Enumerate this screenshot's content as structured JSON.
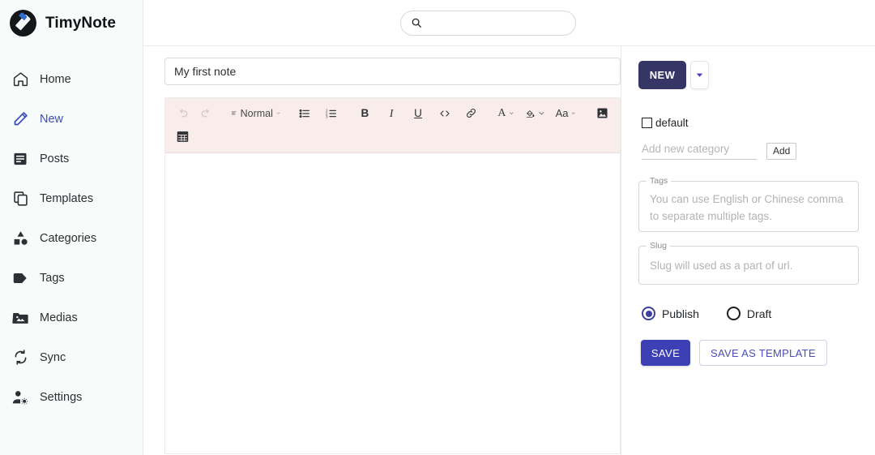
{
  "app": {
    "brand": "TimyNote",
    "logo_icon": "pen-circle-logo"
  },
  "sidebar": {
    "items": [
      {
        "label": "Home",
        "icon": "home-icon",
        "active": false
      },
      {
        "label": "New",
        "icon": "pencil-icon",
        "active": true
      },
      {
        "label": "Posts",
        "icon": "article-icon",
        "active": false
      },
      {
        "label": "Templates",
        "icon": "copy-icon",
        "active": false
      },
      {
        "label": "Categories",
        "icon": "category-icon",
        "active": false
      },
      {
        "label": "Tags",
        "icon": "tag-icon",
        "active": false
      },
      {
        "label": "Medias",
        "icon": "image-folder-icon",
        "active": false
      },
      {
        "label": "Sync",
        "icon": "sync-icon",
        "active": false
      },
      {
        "label": "Settings",
        "icon": "manage-accounts-icon",
        "active": false
      }
    ]
  },
  "topbar": {
    "search": {
      "value": "",
      "placeholder": "",
      "icon": "search-icon"
    }
  },
  "editor": {
    "title": {
      "value": "My first note",
      "placeholder": ""
    },
    "body": {
      "value": ""
    },
    "toolbar": {
      "row1": [
        {
          "name": "undo",
          "icon": "undo-icon",
          "label": "",
          "disabled": true,
          "caret": false
        },
        {
          "name": "redo",
          "icon": "redo-icon",
          "label": "",
          "disabled": true,
          "caret": false
        },
        {
          "name": "paragraph-style",
          "icon": "paragraph-icon",
          "label": "Normal",
          "disabled": false,
          "caret": true
        },
        {
          "name": "bullet-list",
          "icon": "bullet-list-icon",
          "label": "",
          "disabled": false,
          "caret": false
        },
        {
          "name": "numbered-list",
          "icon": "numbered-list-icon",
          "label": "",
          "disabled": false,
          "caret": false
        },
        {
          "name": "bold",
          "icon": "bold-icon",
          "label": "B",
          "disabled": false,
          "caret": false
        },
        {
          "name": "italic",
          "icon": "italic-icon",
          "label": "I",
          "disabled": false,
          "caret": false
        },
        {
          "name": "underline",
          "icon": "underline-icon",
          "label": "U",
          "disabled": false,
          "caret": false
        },
        {
          "name": "code",
          "icon": "code-icon",
          "label": "",
          "disabled": false,
          "caret": false
        },
        {
          "name": "link",
          "icon": "link-icon",
          "label": "",
          "disabled": false,
          "caret": false
        },
        {
          "name": "text-color",
          "icon": "text-color-icon",
          "label": "A",
          "disabled": false,
          "caret": true
        },
        {
          "name": "highlight-color",
          "icon": "fill-color-icon",
          "label": "",
          "disabled": false,
          "caret": true
        },
        {
          "name": "font-size",
          "icon": "font-size-icon",
          "label": "Aa",
          "disabled": false,
          "caret": true
        },
        {
          "name": "insert-image",
          "icon": "image-icon",
          "label": "",
          "disabled": false,
          "caret": false
        }
      ],
      "row2": [
        {
          "name": "insert-table",
          "icon": "table-icon",
          "label": "",
          "disabled": false,
          "caret": false
        }
      ]
    }
  },
  "panel": {
    "new_button": "NEW",
    "new_caret_icon": "chevron-down-icon",
    "category": {
      "checkbox_label": "default",
      "checked": false,
      "add_input": {
        "value": "",
        "placeholder": "Add new category"
      },
      "add_button": "Add"
    },
    "tags": {
      "legend": "Tags",
      "value": "",
      "placeholder": "You can use English or Chinese comma to separate multiple tags."
    },
    "slug": {
      "legend": "Slug",
      "value": "",
      "placeholder": "Slug will used as a part of url."
    },
    "status": {
      "options": [
        {
          "label": "Publish",
          "selected": true
        },
        {
          "label": "Draft",
          "selected": false
        }
      ]
    },
    "actions": {
      "save": "SAVE",
      "save_as_template": "SAVE AS TEMPLATE"
    }
  },
  "colors": {
    "accent": "#3d3fb5",
    "new_button": "#353566",
    "toolbar_bg": "#f8edeb",
    "sidebar_bg": "#f7fbf9"
  }
}
